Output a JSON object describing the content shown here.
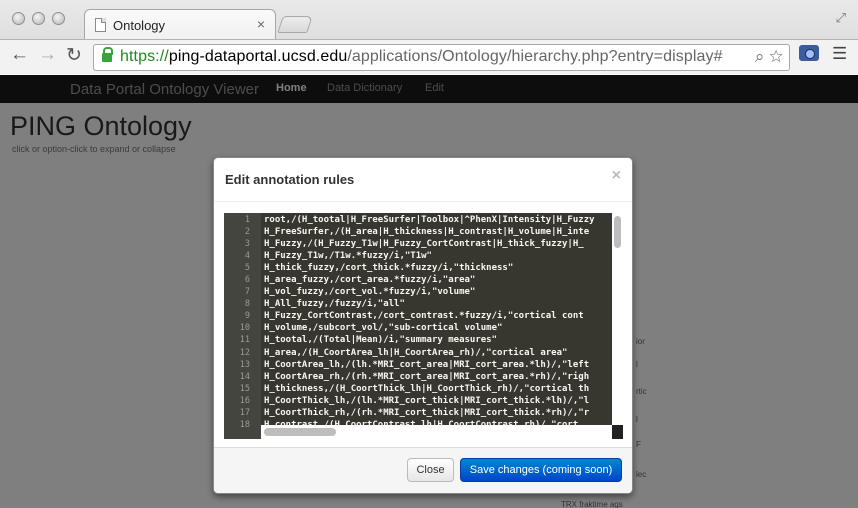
{
  "browser": {
    "tab_title": "Ontology",
    "tab_close": "×",
    "url_scheme": "https://",
    "url_host": "ping-dataportal.ucsd.edu",
    "url_path": "/applications/Ontology/hierarchy.php?entry=display#"
  },
  "page": {
    "brand": "Data Portal Ontology Viewer",
    "nav": [
      "Home",
      "Data Dictionary",
      "Edit"
    ],
    "title": "PING Ontology",
    "hint": "click or option-click to expand or collapse",
    "bg_fragments": [
      "ior",
      "l",
      "rtic",
      "l",
      "F",
      "lec",
      "TRX fraktime ags"
    ]
  },
  "modal": {
    "title": "Edit annotation rules",
    "close_glyph": "×",
    "lines": [
      {
        "n": "1",
        "text": "root,/(H_tootal|H_FreeSurfer|Toolbox|^PhenX|Intensity|H_Fuzzy"
      },
      {
        "n": "2",
        "text": "H_FreeSurfer,/(H_area|H_thickness|H_contrast|H_volume|H_inte"
      },
      {
        "n": "3",
        "text": "H_Fuzzy,/(H_Fuzzy_T1w|H_Fuzzy_CortContrast|H_thick_fuzzy|H_"
      },
      {
        "n": "4",
        "text": "H_Fuzzy_T1w,/T1w.*fuzzy/i,\"T1w\""
      },
      {
        "n": "5",
        "text": "H_thick_fuzzy,/cort_thick.*fuzzy/i,\"thickness\""
      },
      {
        "n": "6",
        "text": "H_area_fuzzy,/cort_area.*fuzzy/i,\"area\""
      },
      {
        "n": "7",
        "text": "H_vol_fuzzy,/cort_vol.*fuzzy/i,\"volume\""
      },
      {
        "n": "8",
        "text": "H_All_fuzzy,/fuzzy/i,\"all\""
      },
      {
        "n": "9",
        "text": "H_Fuzzy_CortContrast,/cort_contrast.*fuzzy/i,\"cortical cont"
      },
      {
        "n": "10",
        "text": "H_volume,/subcort_vol/,\"sub-cortical volume\""
      },
      {
        "n": "11",
        "text": "H_tootal,/(Total|Mean)/i,\"summary measures\""
      },
      {
        "n": "12",
        "text": "H_area,/(H_CoortArea_lh|H_CoortArea_rh)/,\"cortical area\""
      },
      {
        "n": "13",
        "text": "H_CoortArea_lh,/(lh.*MRI_cort_area|MRI_cort_area.*lh)/,\"left"
      },
      {
        "n": "14",
        "text": "H_CoortArea_rh,/(rh.*MRI_cort_area|MRI_cort_area.*rh)/,\"righ"
      },
      {
        "n": "15",
        "text": "H_thickness,/(H_CoortThick_lh|H_CoortThick_rh)/,\"cortical th"
      },
      {
        "n": "16",
        "text": "H_CoortThick_lh,/(lh.*MRI_cort_thick|MRI_cort_thick.*lh)/,\"l"
      },
      {
        "n": "17",
        "text": "H_CoortThick_rh,/(rh.*MRI_cort_thick|MRI_cort_thick.*rh)/,\"r"
      },
      {
        "n": "18",
        "text": "H_contrast,/(H_CoortContrast_lh|H_CoortContrast_rh)/,\"cort"
      }
    ],
    "close_label": "Close",
    "save_label": "Save changes (coming soon)"
  }
}
